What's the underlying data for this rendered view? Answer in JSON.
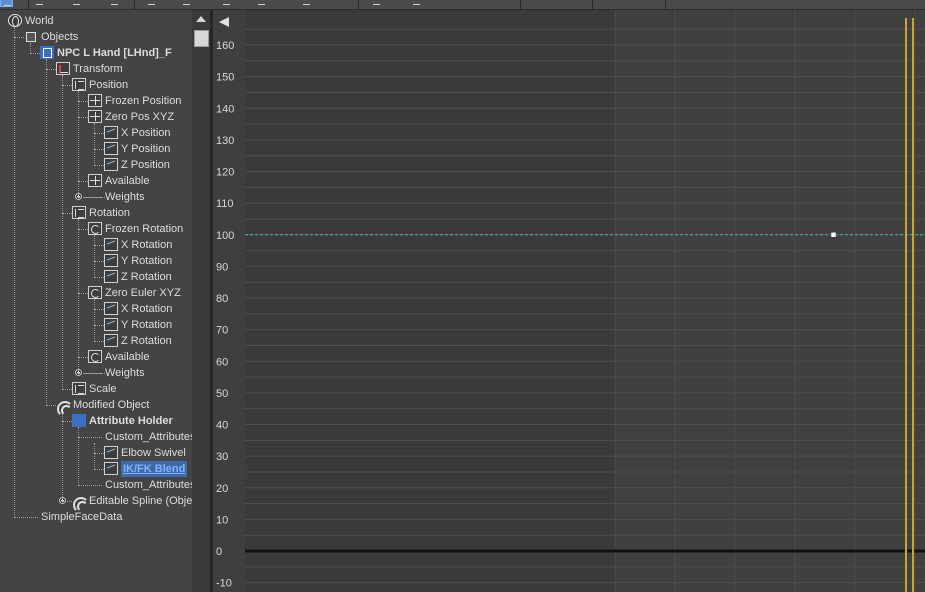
{
  "toolbar": {
    "button_icons": [
      "select-icon",
      "filter-icon",
      "pin-icon",
      "wheel-icon",
      "curve-tool-icon",
      "move-keys-icon",
      "slide-keys-icon",
      "scale-keys-icon",
      "tangent-icon",
      "key-icon",
      "arrow-icon"
    ]
  },
  "tree": {
    "rows": [
      {
        "label": "World",
        "icon": "world",
        "level": 0,
        "bold": false
      },
      {
        "label": "Objects",
        "icon": "cube",
        "level": 1,
        "bold": false
      },
      {
        "label": "NPC L Hand [LHnd]_F",
        "icon": "cubeblue",
        "level": 2,
        "bold": true
      },
      {
        "label": "Transform",
        "icon": "xform",
        "level": 3,
        "bold": false
      },
      {
        "label": "Position",
        "icon": "list",
        "level": 4,
        "bold": false
      },
      {
        "label": "Frozen Position",
        "icon": "pos",
        "level": 5,
        "bold": false
      },
      {
        "label": "Zero Pos XYZ",
        "icon": "pos",
        "level": 5,
        "bold": false
      },
      {
        "label": "X Position",
        "icon": "track",
        "level": 6,
        "bold": false
      },
      {
        "label": "Y Position",
        "icon": "track",
        "level": 6,
        "bold": false
      },
      {
        "label": "Z Position",
        "icon": "track",
        "level": 6,
        "bold": false
      },
      {
        "label": "Available",
        "icon": "pos",
        "level": 5,
        "bold": false
      },
      {
        "label": "Weights",
        "icon": "plus",
        "level": 5,
        "bold": false
      },
      {
        "label": "Rotation",
        "icon": "list",
        "level": 4,
        "bold": false
      },
      {
        "label": "Frozen Rotation",
        "icon": "rot",
        "level": 5,
        "bold": false
      },
      {
        "label": "X Rotation",
        "icon": "track",
        "level": 6,
        "bold": false
      },
      {
        "label": "Y Rotation",
        "icon": "track",
        "level": 6,
        "bold": false
      },
      {
        "label": "Z Rotation",
        "icon": "track",
        "level": 6,
        "bold": false
      },
      {
        "label": "Zero Euler XYZ",
        "icon": "rot",
        "level": 5,
        "bold": false
      },
      {
        "label": "X Rotation",
        "icon": "track",
        "level": 6,
        "bold": false
      },
      {
        "label": "Y Rotation",
        "icon": "track",
        "level": 6,
        "bold": false
      },
      {
        "label": "Z Rotation",
        "icon": "track",
        "level": 6,
        "bold": false
      },
      {
        "label": "Available",
        "icon": "rot",
        "level": 5,
        "bold": false
      },
      {
        "label": "Weights",
        "icon": "plus",
        "level": 5,
        "bold": false
      },
      {
        "label": "Scale",
        "icon": "list",
        "level": 4,
        "bold": false
      },
      {
        "label": "Modified Object",
        "icon": "mod",
        "level": 3,
        "bold": false
      },
      {
        "label": "Attribute Holder",
        "icon": "modblue",
        "level": 4,
        "bold": true
      },
      {
        "label": "Custom_Attributes",
        "icon": "none",
        "level": 5,
        "bold": false
      },
      {
        "label": "Elbow Swivel",
        "icon": "track",
        "level": 6,
        "bold": false
      },
      {
        "label": "IK/FK Blend",
        "icon": "track",
        "level": 6,
        "bold": true,
        "selected": true
      },
      {
        "label": "Custom_Attributes",
        "icon": "none",
        "level": 5,
        "bold": false
      },
      {
        "label": "Editable Spline (Object)",
        "icon": "modplus",
        "level": 4,
        "bold": false
      },
      {
        "label": "SimpleFaceData",
        "icon": "none",
        "level": 1,
        "bold": false
      }
    ]
  },
  "chart_data": {
    "type": "line",
    "title": "",
    "xlabel": "",
    "ylabel": "",
    "ylim": [
      -10,
      160
    ],
    "y_ticks": [
      160,
      150,
      140,
      130,
      120,
      110,
      100,
      90,
      80,
      70,
      60,
      50,
      40,
      30,
      20,
      10,
      0,
      -10
    ],
    "series": [
      {
        "name": "",
        "style": "dashed",
        "color": "#4fb3b3",
        "constant_value": 100
      }
    ],
    "keys": [
      {
        "value": 100
      }
    ],
    "baseline_value": 0,
    "grid": true,
    "time_marker_color": "#c8a82a",
    "colors": {
      "background_left": "#3a3a3a",
      "background_right": "#404040",
      "grid": "#4e4e4e"
    }
  }
}
